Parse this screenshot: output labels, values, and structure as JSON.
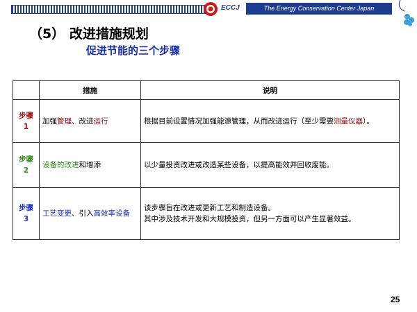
{
  "header": {
    "brand": "ECCJ",
    "org": "The Energy Conservation Center Japan"
  },
  "title": "（5）  改进措施规划",
  "subtitle": "促进节能的三个步骤",
  "table": {
    "col_measure": "措施",
    "col_desc": "说明",
    "rows": [
      {
        "step_label": "步骤",
        "step_num": "1",
        "measure": [
          "加强",
          "管理",
          "、改进",
          "运行"
        ],
        "desc": [
          "根据目前设置情况加强能源管理，从而改进运行（至少需要",
          "测量仪器",
          "）。"
        ]
      },
      {
        "step_label": "步骤",
        "step_num": "2",
        "measure": [
          "设备的改进",
          "和增添"
        ],
        "desc": [
          "以少量投资改进或改造某些设备，以提高能效并回收废能。"
        ]
      },
      {
        "step_label": "步骤",
        "step_num": "3",
        "measure": [
          "工艺变更",
          "、引入",
          "高效率设备"
        ],
        "desc": [
          "该步骤旨在改进或更新工艺和制造设备。",
          "其中涉及技术开发和大规模投资，但另一方面可以产生显著效益。"
        ]
      }
    ]
  },
  "page_number": "25"
}
